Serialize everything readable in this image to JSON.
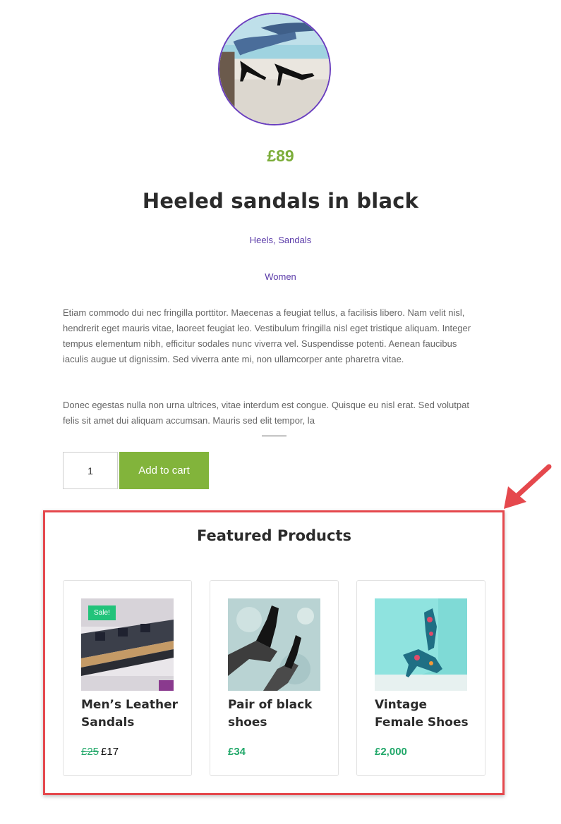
{
  "product": {
    "price": "£89",
    "title": "Heeled sandals in black",
    "categories": [
      "Heels",
      "Sandals"
    ],
    "categories_separator": ", ",
    "tag": "Women",
    "description": [
      "Etiam commodo dui nec fringilla porttitor. Maecenas a feugiat tellus, a facilisis libero. Nam velit nisl, hendrerit eget mauris vitae, laoreet feugiat leo. Vestibulum fringilla nisl eget tristique aliquam. Integer tempus elementum nibh, efficitur sodales nunc viverra vel. Suspendisse potenti. Aenean faucibus iaculis augue ut dignissim. Sed viverra ante mi, non ullamcorper ante pharetra vitae.",
      "Donec egestas nulla non urna ultrices, vitae interdum est congue. Quisque eu nisl erat. Sed volutpat felis sit amet dui aliquam accumsan. Mauris sed elit tempor, la"
    ],
    "quantity": "1",
    "add_to_cart_label": "Add to cart",
    "image_icon": "heeled-sandals-photo"
  },
  "featured": {
    "title": "Featured Products",
    "products": [
      {
        "name": "Men’s Leather Sandals",
        "badge": "Sale!",
        "old_price": "£25",
        "price": "£17",
        "image_icon": "sandals-rack-photo"
      },
      {
        "name": "Pair of black shoes",
        "price": "£34",
        "image_icon": "black-heels-photo"
      },
      {
        "name": "Vintage Female Shoes",
        "price": "£2,000",
        "image_icon": "floral-heels-photo"
      }
    ]
  },
  "colors": {
    "accent_purple": "#6a3fbf",
    "price_green": "#7cad3a",
    "button_green": "#82b43b",
    "sale_green": "#22c37a",
    "highlight_red": "#e5484d"
  }
}
